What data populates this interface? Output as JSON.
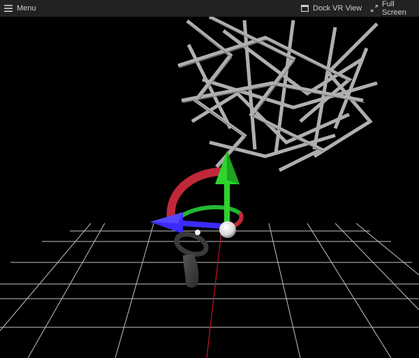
{
  "toolbar": {
    "menu_label": "Menu",
    "dock_label": "Dock VR View",
    "fullscreen_label": "Full Screen"
  },
  "icons": {
    "menu": "hamburger-menu-icon",
    "dock": "dock-window-icon",
    "fullscreen": "expand-arrows-icon"
  },
  "scene": {
    "gizmo_colors": {
      "x_axis": "#3b2bff",
      "y_axis": "#2fd32f",
      "rotation_ring_red": "#c0283a",
      "rotation_ring_green": "#23b834",
      "center_sphere": "#eeeeee"
    },
    "grid_color": "#d9d9d9",
    "grid_center_line_color": "#c4142c",
    "wire_sculpture_color": "#b9b9b9"
  }
}
